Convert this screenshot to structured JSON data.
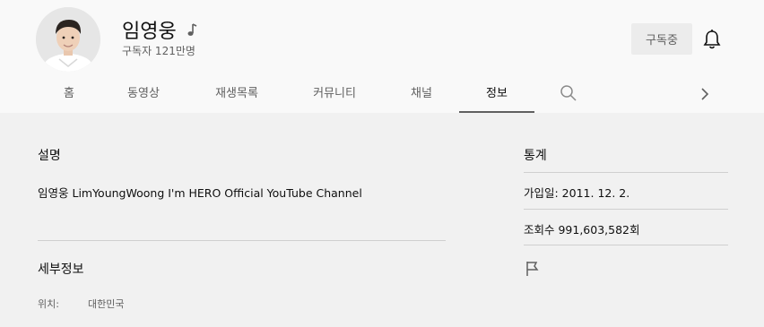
{
  "channel": {
    "name": "임영웅",
    "subscribers": "구독자 121만명",
    "subscribe_label": "구독중"
  },
  "tabs": [
    {
      "label": "홈"
    },
    {
      "label": "동영상"
    },
    {
      "label": "재생목록"
    },
    {
      "label": "커뮤니티"
    },
    {
      "label": "채널"
    },
    {
      "label": "정보"
    }
  ],
  "about": {
    "description_title": "설명",
    "description": "임영웅 LimYoungWoong I'm HERO Official YouTube Channel",
    "details_title": "세부정보",
    "location_label": "위치:",
    "location_value": "대한민국"
  },
  "stats": {
    "title": "통계",
    "joined": "가입일: 2011. 12. 2.",
    "views": "조회수 991,603,582회"
  },
  "icons": {
    "music_note": "music-note-icon",
    "bell": "bell-icon",
    "search": "search-icon",
    "next": "chevron-right-icon",
    "flag": "flag-icon"
  }
}
